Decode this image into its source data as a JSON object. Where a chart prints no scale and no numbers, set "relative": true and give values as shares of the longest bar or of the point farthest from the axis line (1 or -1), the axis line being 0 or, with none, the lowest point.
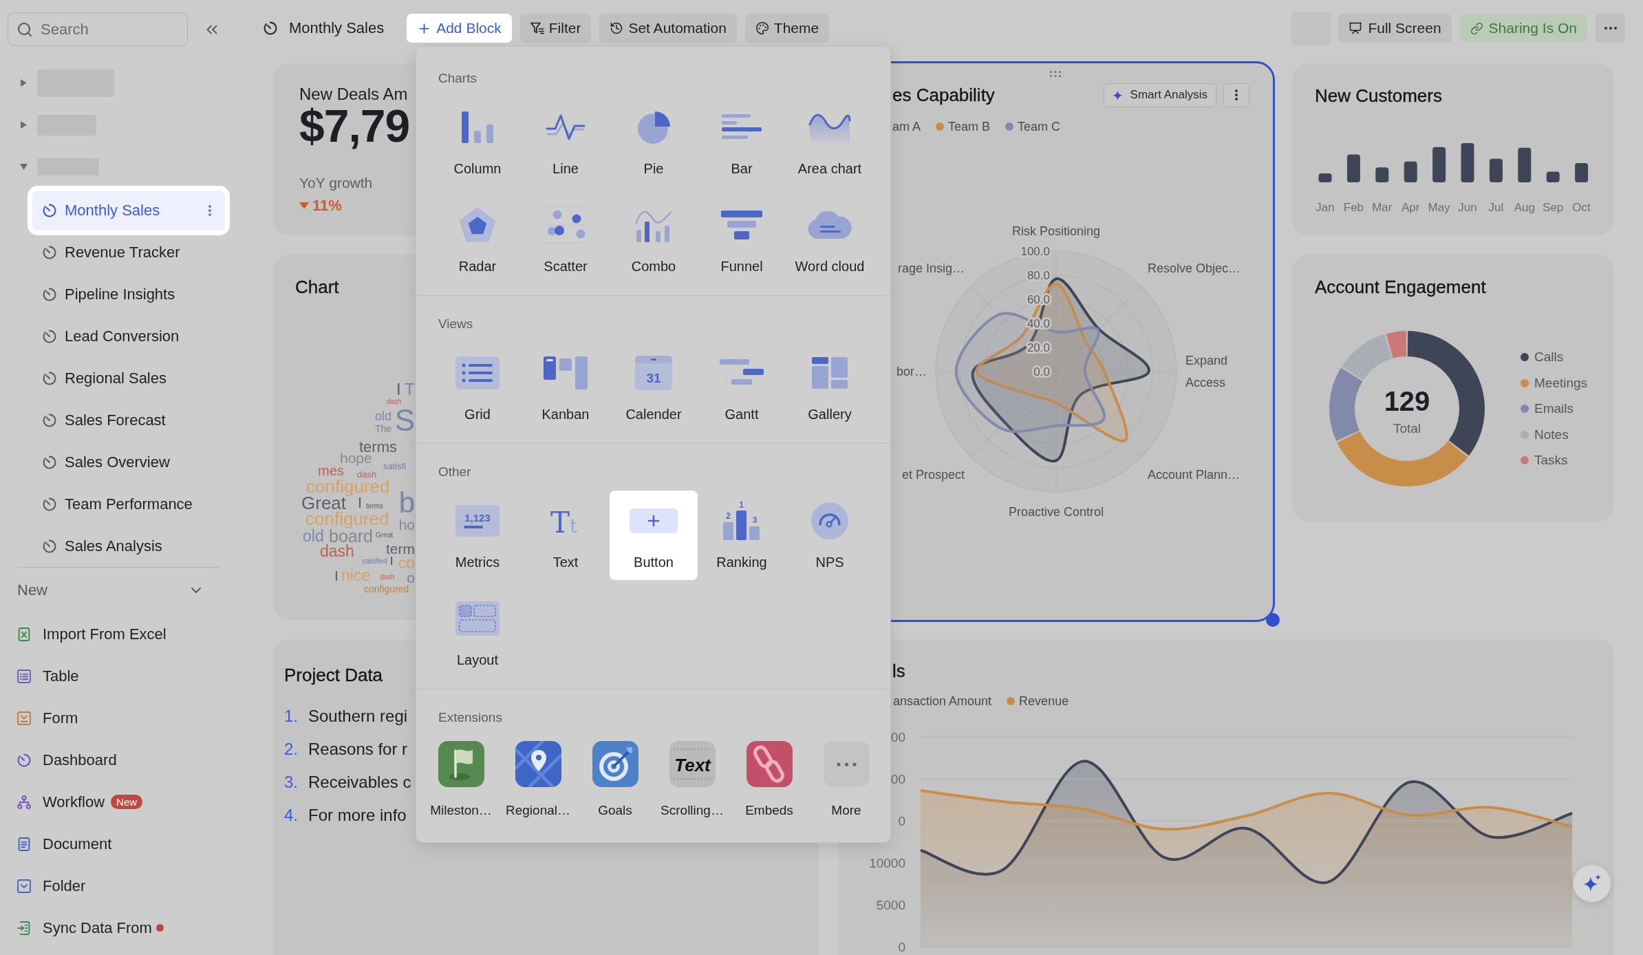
{
  "sidebar": {
    "search": {
      "placeholder": "Search"
    },
    "folders": [
      {
        "expanded": false
      },
      {
        "expanded": false
      },
      {
        "expanded": true,
        "children": [
          {
            "label": "Monthly Sales",
            "selected": true
          },
          {
            "label": "Revenue Tracker",
            "selected": false
          },
          {
            "label": "Pipeline Insights",
            "selected": false
          },
          {
            "label": "Lead Conversion",
            "selected": false
          },
          {
            "label": "Regional Sales",
            "selected": false
          },
          {
            "label": "Sales Forecast",
            "selected": false
          },
          {
            "label": "Sales Overview",
            "selected": false
          },
          {
            "label": "Team Performance",
            "selected": false
          },
          {
            "label": "Sales Analysis",
            "selected": false
          }
        ]
      }
    ],
    "new_section": {
      "title": "New",
      "expanded": true,
      "items": [
        {
          "label": "Import From Excel",
          "unread": false
        },
        {
          "label": "Table",
          "unread": false
        },
        {
          "label": "Form",
          "unread": false
        },
        {
          "label": "Dashboard",
          "unread": false
        },
        {
          "label": "Workflow",
          "badge": "New",
          "unread": false
        },
        {
          "label": "Document",
          "unread": false
        },
        {
          "label": "Folder",
          "unread": false
        },
        {
          "label": "Sync Data From",
          "unread": true
        }
      ]
    }
  },
  "toolbar": {
    "title": "Monthly Sales",
    "actions": [
      {
        "label": "Add Block",
        "active": true
      },
      {
        "label": "Filter",
        "active": false
      },
      {
        "label": "Set Automation",
        "active": false
      },
      {
        "label": "Theme",
        "active": false
      }
    ],
    "right_actions": [
      {
        "kind": "fullscreen",
        "label": "Full Screen"
      },
      {
        "kind": "sharing",
        "label": "Sharing Is On"
      }
    ]
  },
  "dashboard": {
    "metric_card": {
      "title": "New Deals Am",
      "value": "$7,79",
      "caption": "YoY growth",
      "change": "11%",
      "negative": true
    },
    "word_cloud_card": {
      "title": "Chart",
      "words": [
        {
          "text": "I",
          "color": "#5b5f67"
        },
        {
          "text": "T",
          "color": "#7b85ad"
        },
        {
          "text": "dash",
          "color": "#b9605a"
        },
        {
          "text": "old",
          "color": "#7b85ad"
        },
        {
          "text": "The",
          "color": "#7c8089"
        },
        {
          "text": "S",
          "color": "#7b85ad"
        },
        {
          "text": "terms",
          "color": "#5b5f67"
        },
        {
          "text": "hope",
          "color": "#85878f"
        },
        {
          "text": "satisfi",
          "color": "#6f7bab"
        },
        {
          "text": "mes",
          "color": "#b9605a"
        },
        {
          "text": "dash",
          "color": "#b9605a"
        },
        {
          "text": "configured",
          "color": "#d6a263"
        },
        {
          "text": "Great",
          "color": "#5b5f67"
        },
        {
          "text": "I",
          "color": "#5b5f67"
        },
        {
          "text": "terms",
          "color": "#5b5f67"
        },
        {
          "text": "b",
          "color": "#7b85ad"
        },
        {
          "text": "configured",
          "color": "#d6a263"
        },
        {
          "text": "ho",
          "color": "#85878f"
        },
        {
          "text": "old",
          "color": "#7b85ad"
        },
        {
          "text": "board",
          "color": "#85878f"
        },
        {
          "text": "Great",
          "color": "#5b5f67"
        },
        {
          "text": "term",
          "color": "#5b5f67"
        },
        {
          "text": "dash",
          "color": "#b9605a"
        },
        {
          "text": "satisfied",
          "color": "#6f7bab"
        },
        {
          "text": "I",
          "color": "#3f434b"
        },
        {
          "text": "co",
          "color": "#d6a263"
        },
        {
          "text": "I",
          "color": "#5b5f67"
        },
        {
          "text": "nice",
          "color": "#d6a263"
        },
        {
          "text": "dash",
          "color": "#b9605a"
        },
        {
          "text": "o",
          "color": "#7b85ad"
        },
        {
          "text": "configured",
          "color": "#b88545"
        }
      ]
    },
    "radar_card": {
      "title": "es Capability",
      "selected": true,
      "smart_button": "Smart Analysis",
      "legend": [
        {
          "label": "am A"
        },
        {
          "label": "Team B",
          "color": "#c98d4a"
        },
        {
          "label": "Team C",
          "color": "#8389ab"
        }
      ],
      "axis_labels": [
        "Risk Positioning",
        "rage Insig…",
        "Resolve Objec…",
        "bor…",
        "Expand Access",
        "et Prospect",
        "Account Plann…",
        "Proactive Control"
      ],
      "ring_labels": [
        "100.0",
        "80.0",
        "60.0",
        "40.0",
        "20.0",
        "0.0"
      ]
    },
    "new_customers_card": {
      "title": "New Customers",
      "chart_data": {
        "type": "bar",
        "relative": true,
        "categories": [
          "Jan",
          "Feb",
          "Mar",
          "Apr",
          "May",
          "Jun",
          "Jul",
          "Aug",
          "Sep",
          "Oct"
        ],
        "values": [
          0.23,
          0.71,
          0.38,
          0.53,
          0.9,
          1,
          0.6,
          0.88,
          0.27,
          0.49
        ]
      }
    },
    "engagement_card": {
      "title": "Account Engagement",
      "total": "129",
      "total_label": "Total",
      "legend": [
        {
          "label": "Calls",
          "color": "#3d4556"
        },
        {
          "label": "Meetings",
          "color": "#c98d4a"
        },
        {
          "label": "Emails",
          "color": "#8389ab"
        },
        {
          "label": "Notes",
          "color": "#a9adb4"
        },
        {
          "label": "Tasks",
          "color": "#c97a78"
        }
      ],
      "chart_data": {
        "type": "donut",
        "values": [
          35.5,
          32.5,
          16,
          11.5,
          4.5
        ]
      }
    },
    "list_card": {
      "title": "Project Data",
      "items": [
        {
          "number": "1.",
          "text": "Southern regi"
        },
        {
          "number": "2.",
          "text": "Reasons for r"
        },
        {
          "number": "3.",
          "text": "Receivables c"
        },
        {
          "number": "4.",
          "text": "For more info"
        }
      ]
    },
    "trend_card": {
      "title": "ls",
      "legend": [
        {
          "label": "ansaction Amount"
        },
        {
          "label": "Revenue",
          "color": "#c98d4a"
        }
      ],
      "cut_tick_labels": [
        "00",
        "00",
        "0"
      ],
      "chart_data": {
        "type": "line",
        "categories": [
          null,
          null,
          null,
          null,
          null,
          null,
          null,
          null,
          null
        ],
        "ylim": [
          0,
          25000
        ],
        "yticks": [
          0,
          5000,
          10000
        ],
        "grid": true,
        "series": [
          {
            "color": "#3d4556",
            "values": [
              11500,
              9100,
              22100,
              10600,
              14100,
              7700,
              19600,
              13100,
              15900
            ]
          },
          {
            "color": "#c98d4a",
            "values": [
              18600,
              17300,
              16400,
              14000,
              15600,
              18300,
              15700,
              16600,
              14300
            ]
          }
        ]
      }
    }
  },
  "add_block_menu": {
    "sections": [
      {
        "kind": "charts",
        "title": "Charts",
        "items": [
          {
            "label": "Column",
            "highlighted": false
          },
          {
            "label": "Line",
            "highlighted": false
          },
          {
            "label": "Pie",
            "highlighted": false
          },
          {
            "label": "Bar",
            "highlighted": false
          },
          {
            "label": "Area chart",
            "highlighted": false
          },
          {
            "label": "Radar",
            "highlighted": false
          },
          {
            "label": "Scatter",
            "highlighted": false
          },
          {
            "label": "Combo",
            "highlighted": false
          },
          {
            "label": "Funnel",
            "highlighted": false
          },
          {
            "label": "Word cloud",
            "highlighted": false
          }
        ]
      },
      {
        "kind": "views",
        "title": "Views",
        "items": [
          {
            "label": "Grid",
            "highlighted": false
          },
          {
            "label": "Kanban",
            "highlighted": false
          },
          {
            "label": "Calender",
            "icon_text": "31",
            "highlighted": false
          },
          {
            "label": "Gantt",
            "highlighted": false
          },
          {
            "label": "Gallery",
            "highlighted": false
          }
        ]
      },
      {
        "kind": "other",
        "title": "Other",
        "items": [
          {
            "label": "Metrics",
            "icon_text": "1,123",
            "highlighted": false
          },
          {
            "label": "Text",
            "icon_text": "Tt",
            "highlighted": false
          },
          {
            "label": "Button",
            "highlighted": true
          },
          {
            "label": "Ranking",
            "icon_text": [
              "1",
              "2",
              "3"
            ],
            "highlighted": false
          },
          {
            "label": "NPS",
            "highlighted": false
          },
          {
            "label": "Layout",
            "highlighted": false
          }
        ]
      },
      {
        "kind": "extensions",
        "title": "Extensions",
        "items": [
          {
            "label": "Mileston…",
            "highlighted": false
          },
          {
            "label": "Regional…",
            "highlighted": false
          },
          {
            "label": "Goals",
            "highlighted": false
          },
          {
            "label": "Scrolling…",
            "icon_text": "Text",
            "highlighted": false
          },
          {
            "label": "Embeds",
            "highlighted": false
          },
          {
            "label": "More",
            "highlighted": false
          }
        ]
      }
    ]
  }
}
